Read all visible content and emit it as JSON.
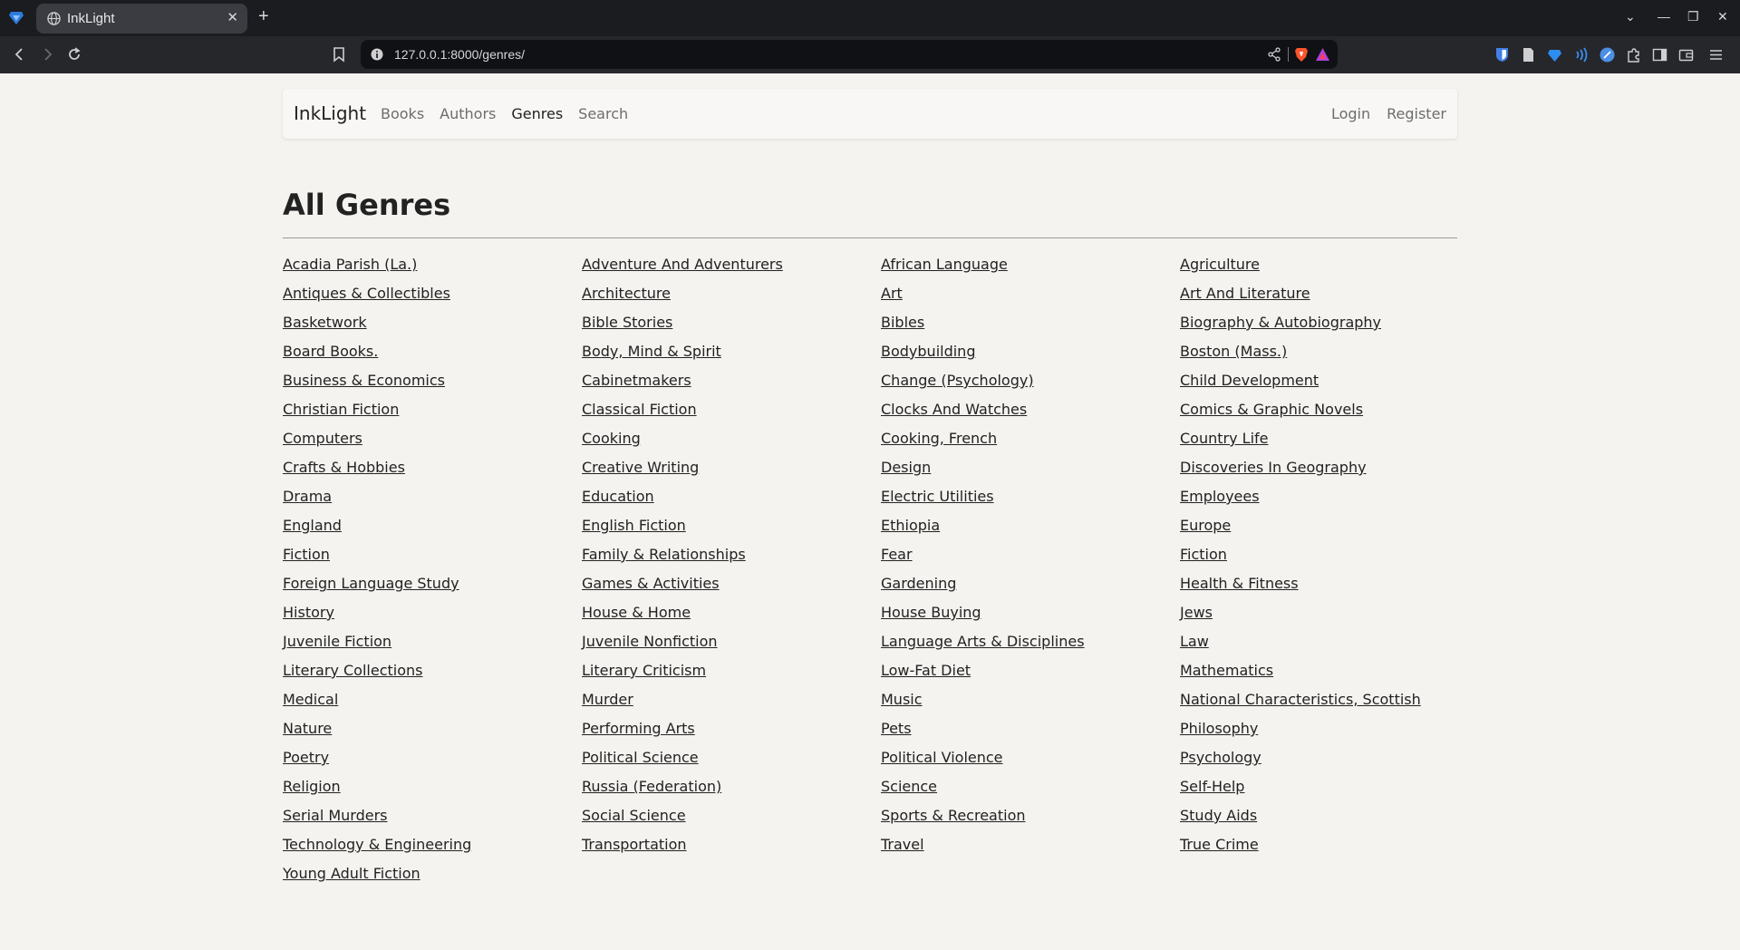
{
  "browser": {
    "tab_title": "InkLight",
    "url": "127.0.0.1:8000/genres/",
    "new_tab": "+",
    "tab_close": "✕",
    "window_controls": [
      "⌄",
      "—",
      "❐",
      "✕"
    ]
  },
  "site": {
    "brand": "InkLight",
    "nav": [
      "Books",
      "Authors",
      "Genres",
      "Search"
    ],
    "active_nav": "Genres",
    "auth": [
      "Login",
      "Register"
    ]
  },
  "page": {
    "title": "All Genres"
  },
  "genres": [
    "Acadia Parish (La.)",
    "Adventure And Adventurers",
    "African Language",
    "Agriculture",
    "Antiques & Collectibles",
    "Architecture",
    "Art",
    "Art And Literature",
    "Basketwork",
    "Bible Stories",
    "Bibles",
    "Biography & Autobiography",
    "Board Books.",
    "Body, Mind & Spirit",
    "Bodybuilding",
    "Boston (Mass.)",
    "Business & Economics",
    "Cabinetmakers",
    "Change (Psychology)",
    "Child Development",
    "Christian Fiction",
    "Classical Fiction",
    "Clocks And Watches",
    "Comics & Graphic Novels",
    "Computers",
    "Cooking",
    "Cooking, French",
    "Country Life",
    "Crafts & Hobbies",
    "Creative Writing",
    "Design",
    "Discoveries In Geography",
    "Drama",
    "Education",
    "Electric Utilities",
    "Employees",
    "England",
    "English Fiction",
    "Ethiopia",
    "Europe",
    "Fiction",
    "Family & Relationships",
    "Fear",
    "Fiction",
    "Foreign Language Study",
    "Games & Activities",
    "Gardening",
    "Health & Fitness",
    "History",
    "House & Home",
    "House Buying",
    "Jews",
    "Juvenile Fiction",
    "Juvenile Nonfiction",
    "Language Arts & Disciplines",
    "Law",
    "Literary Collections",
    "Literary Criticism",
    "Low-Fat Diet",
    "Mathematics",
    "Medical",
    "Murder",
    "Music",
    "National Characteristics, Scottish",
    "Nature",
    "Performing Arts",
    "Pets",
    "Philosophy",
    "Poetry",
    "Political Science",
    "Political Violence",
    "Psychology",
    "Religion",
    "Russia (Federation)",
    "Science",
    "Self-Help",
    "Serial Murders",
    "Social Science",
    "Sports & Recreation",
    "Study Aids",
    "Technology & Engineering",
    "Transportation",
    "Travel",
    "True Crime",
    "Young Adult Fiction"
  ]
}
